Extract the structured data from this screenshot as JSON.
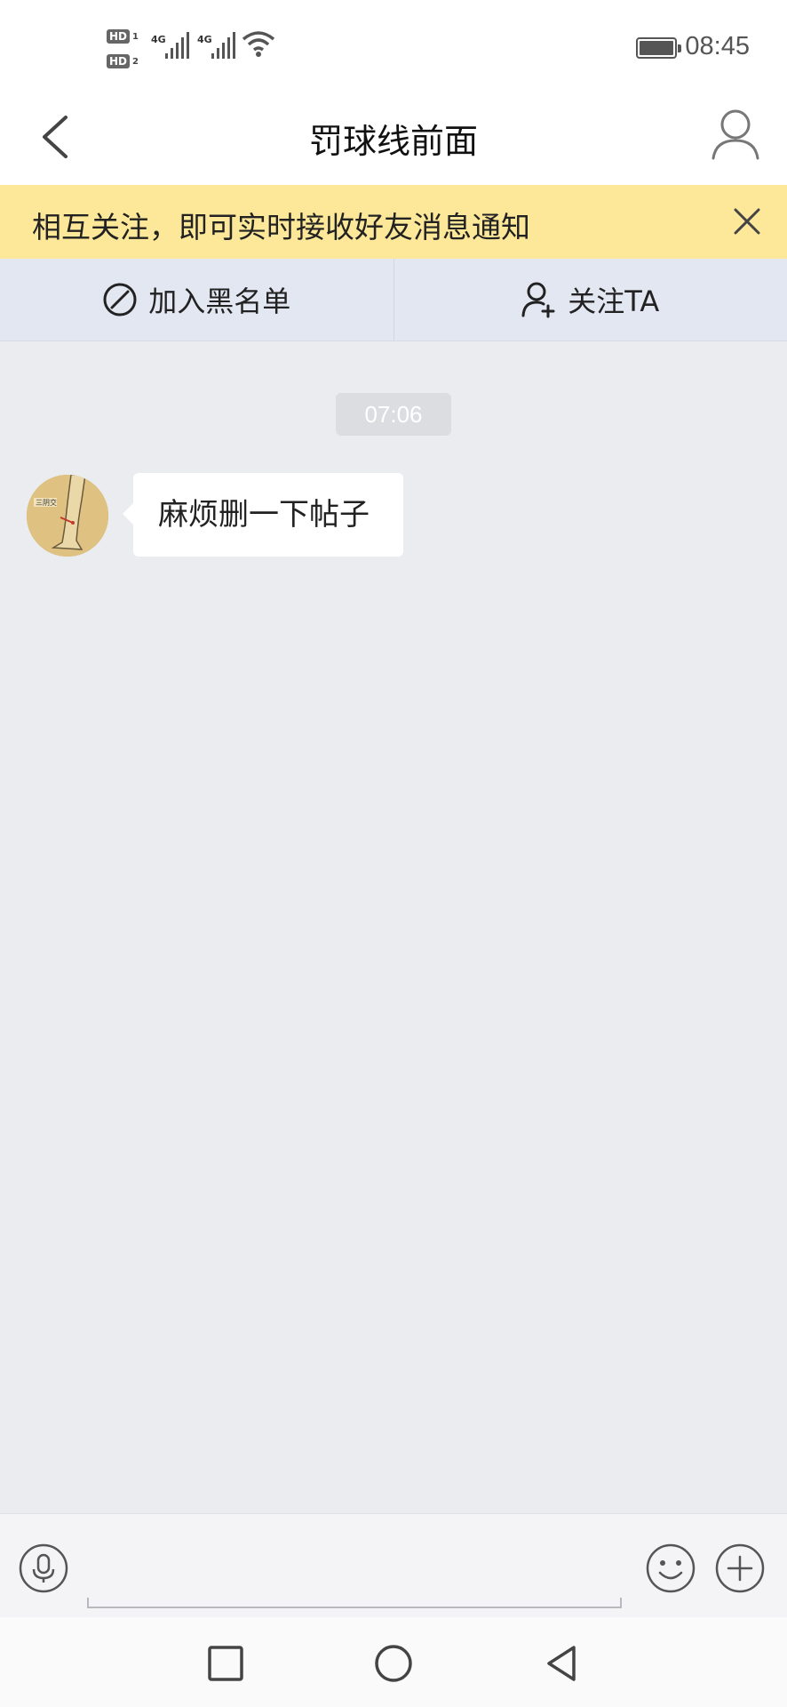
{
  "status_bar": {
    "hd1": "HD",
    "hd1_sub": "1",
    "hd2": "HD",
    "hd2_sub": "2",
    "network1": "4G",
    "network2": "4G",
    "time": "08:45"
  },
  "header": {
    "title": "罚球线前面"
  },
  "banner": {
    "text": "相互关注，即可实时接收好友消息通知"
  },
  "actions": {
    "blacklist_label": "加入黑名单",
    "follow_label": "关注TA"
  },
  "chat": {
    "timestamp": "07:06",
    "messages": [
      {
        "text": "麻烦删一下帖子"
      }
    ]
  },
  "input": {
    "placeholder": "",
    "value": ""
  },
  "colors": {
    "banner_bg": "#fde89a",
    "action_bg": "#e3e7f1",
    "chat_bg": "#ebecf0"
  },
  "icons": {
    "back": "chevron-left-icon",
    "profile": "user-icon",
    "close": "close-icon",
    "blacklist": "block-icon",
    "follow": "add-user-icon",
    "voice": "microphone-icon",
    "emoji": "smile-icon",
    "more": "plus-circle-icon"
  }
}
